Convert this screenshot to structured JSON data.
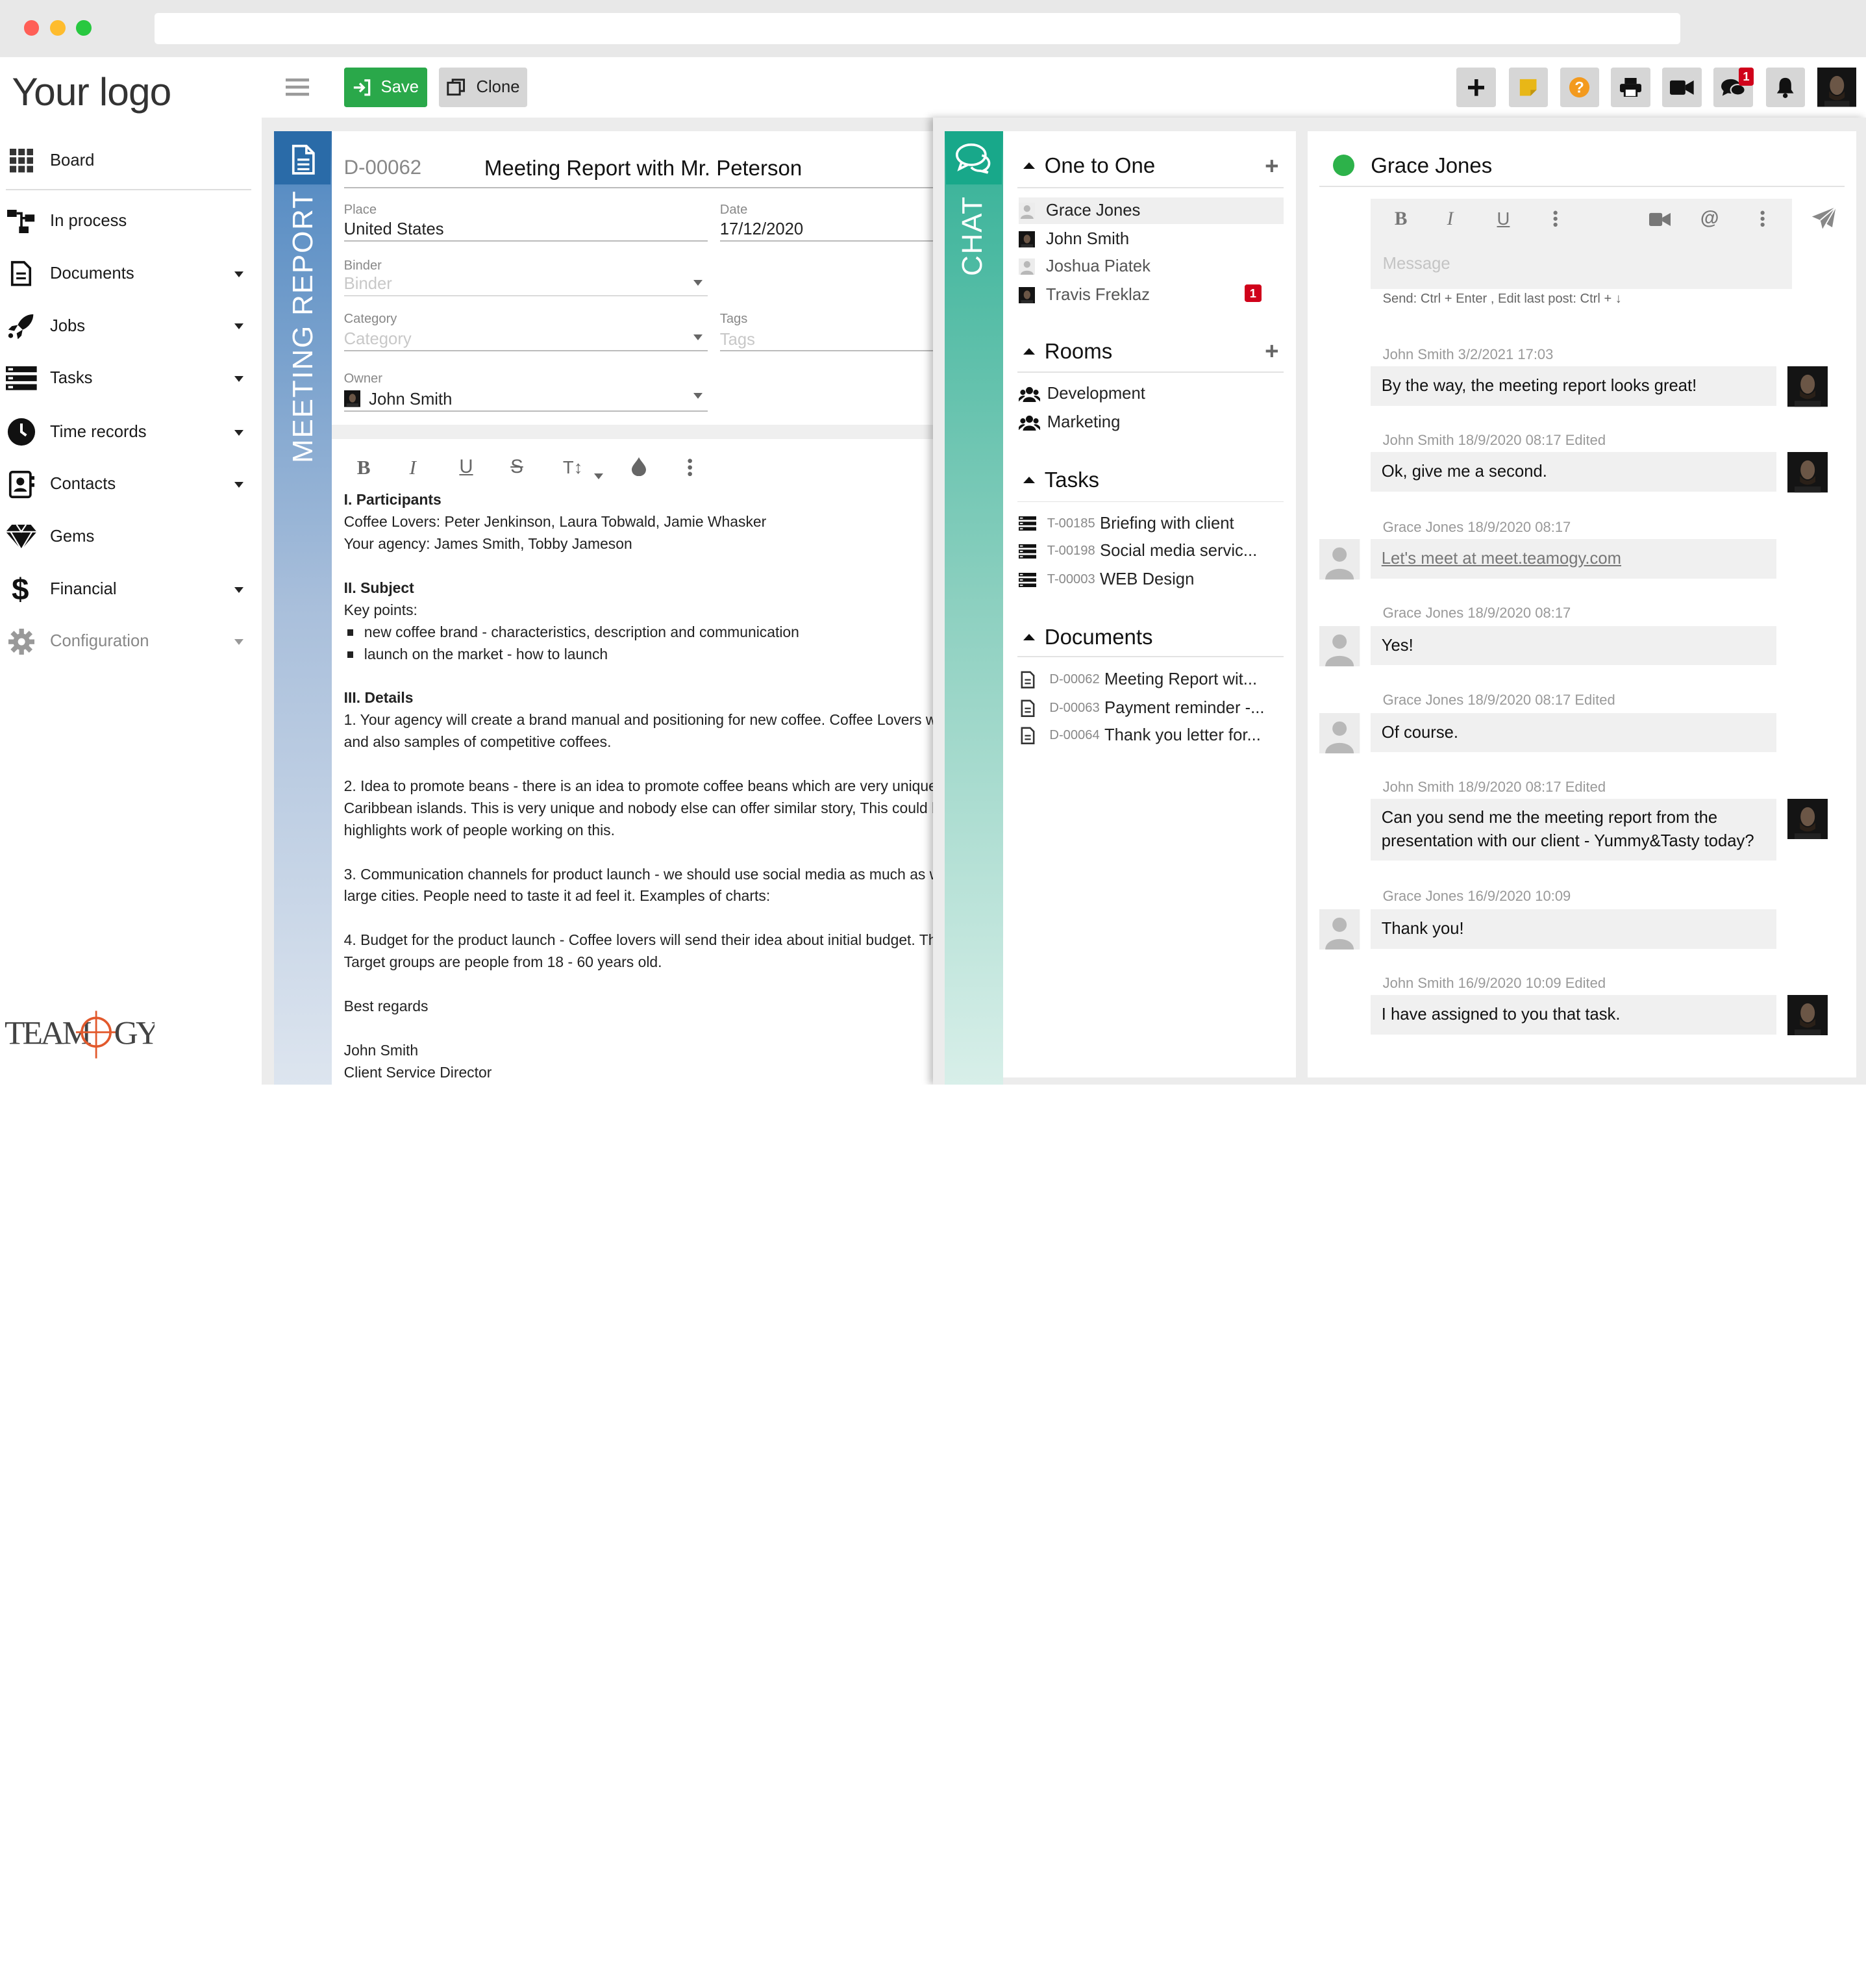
{
  "app": {
    "logo": "Your logo",
    "brand": "TEAMOGY"
  },
  "sidebar": {
    "items": [
      {
        "label": "Board",
        "icon": "grid-icon",
        "caret": false
      },
      {
        "label": "In process",
        "icon": "flow-icon",
        "caret": false
      },
      {
        "label": "Documents",
        "icon": "document-icon",
        "caret": true
      },
      {
        "label": "Jobs",
        "icon": "rocket-icon",
        "caret": true
      },
      {
        "label": "Tasks",
        "icon": "tasks-icon",
        "caret": true
      },
      {
        "label": "Time records",
        "icon": "clock-icon",
        "caret": true
      },
      {
        "label": "Contacts",
        "icon": "contacts-icon",
        "caret": true
      },
      {
        "label": "Gems",
        "icon": "gem-icon",
        "caret": false
      },
      {
        "label": "Financial",
        "icon": "dollar-icon",
        "caret": true
      },
      {
        "label": "Configuration",
        "icon": "gear-icon",
        "caret": true
      }
    ]
  },
  "toolbar": {
    "save_label": "Save",
    "clone_label": "Clone",
    "chat_badge": "1"
  },
  "report": {
    "strip_label": "MEETING REPORT",
    "id": "D-00062",
    "title": "Meeting Report with Mr. Peterson",
    "place_label": "Place",
    "place_value": "United States",
    "date_label": "Date",
    "date_value": "17/12/2020",
    "binder_label": "Binder",
    "binder_placeholder": "Binder",
    "category_label": "Category",
    "category_placeholder": "Category",
    "tags_label": "Tags",
    "tags_placeholder": "Tags",
    "owner_label": "Owner",
    "owner_value": "John Smith",
    "editor_font_size": "T↕",
    "body": [
      {
        "text": "I. Participants",
        "bold": true
      },
      {
        "text": "Coffee Lovers: Peter Jenkinson, Laura Tobwald, Jamie Whasker"
      },
      {
        "text": "Your agency: James Smith, Tobby Jameson"
      },
      {
        "text": ""
      },
      {
        "text": "II. Subject",
        "bold": true
      },
      {
        "text": "Key points:"
      },
      {
        "text": "new coffee brand - characteristics, description and communication",
        "bullet": true
      },
      {
        "text": "launch on the market - how to launch",
        "bullet": true
      },
      {
        "text": ""
      },
      {
        "text": "III. Details",
        "bold": true
      },
      {
        "text": "1. Your agency will create a brand manual and positioning for new coffee.  Coffee Lovers w"
      },
      {
        "text": "and also samples of competitive coffees."
      },
      {
        "text": ""
      },
      {
        "text": "2. Idea to promote beans - there is an idea to promote coffee beans which are very unique."
      },
      {
        "text": "Caribbean islands. This is very unique and nobody else can offer similar story, This could b"
      },
      {
        "text": "highlights work of people working on this."
      },
      {
        "text": ""
      },
      {
        "text": "3. Communication channels for product launch - we should use social media as much as w"
      },
      {
        "text": "large cities. People need to taste it ad feel it. Examples of charts:"
      },
      {
        "text": ""
      },
      {
        "text": "4. Budget for the product launch - Coffee lovers will send their idea about initial budget. The"
      },
      {
        "text": "Target groups are people from 18 - 60 years old."
      },
      {
        "text": ""
      },
      {
        "text": "Best regards"
      },
      {
        "text": ""
      },
      {
        "text": "John Smith"
      },
      {
        "text": "Client Service Director"
      }
    ]
  },
  "chat": {
    "strip_label": "CHAT",
    "one_to_one": {
      "title": "One to One",
      "contacts": [
        {
          "name": "Grace Jones",
          "photo": false,
          "selected": true,
          "badge": ""
        },
        {
          "name": "John Smith",
          "photo": true,
          "selected": false,
          "badge": ""
        },
        {
          "name": "Joshua Piatek",
          "photo": false,
          "selected": false,
          "badge": ""
        },
        {
          "name": "Travis Freklaz",
          "photo": true,
          "selected": false,
          "badge": "1"
        }
      ]
    },
    "rooms": {
      "title": "Rooms",
      "items": [
        "Development",
        "Marketing"
      ]
    },
    "tasks": {
      "title": "Tasks",
      "items": [
        {
          "code": "T-00185",
          "name": "Briefing with client"
        },
        {
          "code": "T-00198",
          "name": "Social media servic..."
        },
        {
          "code": "T-00003",
          "name": "WEB Design"
        }
      ]
    },
    "documents": {
      "title": "Documents",
      "items": [
        {
          "code": "D-00062",
          "name": "Meeting Report wit..."
        },
        {
          "code": "D-00063",
          "name": "Payment reminder -..."
        },
        {
          "code": "D-00064",
          "name": "Thank you letter for..."
        }
      ]
    },
    "conversation": {
      "contact": "Grace Jones",
      "status_color": "#2db24a",
      "message_placeholder": "Message",
      "hint": "Send: Ctrl + Enter , Edit last post: Ctrl + ↓",
      "messages": [
        {
          "meta": "John Smith  3/2/2021  17:03",
          "text": [
            "By the way, the meeting report looks great!"
          ],
          "own": true
        },
        {
          "meta": "John Smith  18/9/2020  08:17  Edited",
          "text": [
            "Ok, give me a second."
          ],
          "own": true
        },
        {
          "meta": "Grace Jones  18/9/2020  08:17",
          "text": [
            "Let's meet at meet.teamogy.com"
          ],
          "own": false,
          "link": true
        },
        {
          "meta": "Grace Jones  18/9/2020  08:17",
          "text": [
            "Yes!"
          ],
          "own": false
        },
        {
          "meta": "Grace Jones  18/9/2020  08:17  Edited",
          "text": [
            "Of course."
          ],
          "own": false
        },
        {
          "meta": "John Smith  18/9/2020  08:17  Edited",
          "text": [
            "Can you send me the meeting report from the",
            "presentation with our client - Yummy&Tasty today?"
          ],
          "own": true
        },
        {
          "meta": "Grace Jones  16/9/2020  10:09",
          "text": [
            "Thank you!"
          ],
          "own": false
        },
        {
          "meta": "John Smith  16/9/2020  10:09  Edited",
          "text": [
            "I have assigned to you that task."
          ],
          "own": true
        }
      ]
    }
  },
  "colors": {
    "save_green": "#2aa84a",
    "report_blue": "#2a6ba8",
    "chat_teal": "#18a88a",
    "badge_red": "#d0021b"
  }
}
